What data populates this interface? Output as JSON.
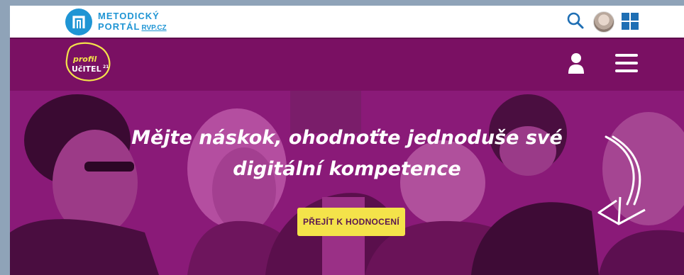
{
  "topbar": {
    "logo": {
      "line1": "METODICKÝ",
      "line2": "PORTÁL",
      "line2_suffix": "RVP.CZ"
    }
  },
  "navbar": {
    "logo": {
      "line1": "profil",
      "line2": "UčITEL",
      "superscript": "21"
    }
  },
  "hero": {
    "title_line1": "Mějte náskok, ohodnoťte jednoduše své",
    "title_line2": "digitální kompetence",
    "cta_label": "PŘEJÍT K HODNOCENÍ"
  },
  "colors": {
    "brand_blue": "#1f95d4",
    "navbar_purple": "#7a1063",
    "hero_purple": "#8a1a78",
    "cta_yellow": "#f4e34a"
  },
  "icons": [
    "metodicky-portal-logo-icon",
    "search-icon",
    "avatar",
    "apps-grid-icon",
    "profil-ucitel-logo",
    "user-icon",
    "hamburger-menu-icon",
    "curved-arrow-icon"
  ]
}
